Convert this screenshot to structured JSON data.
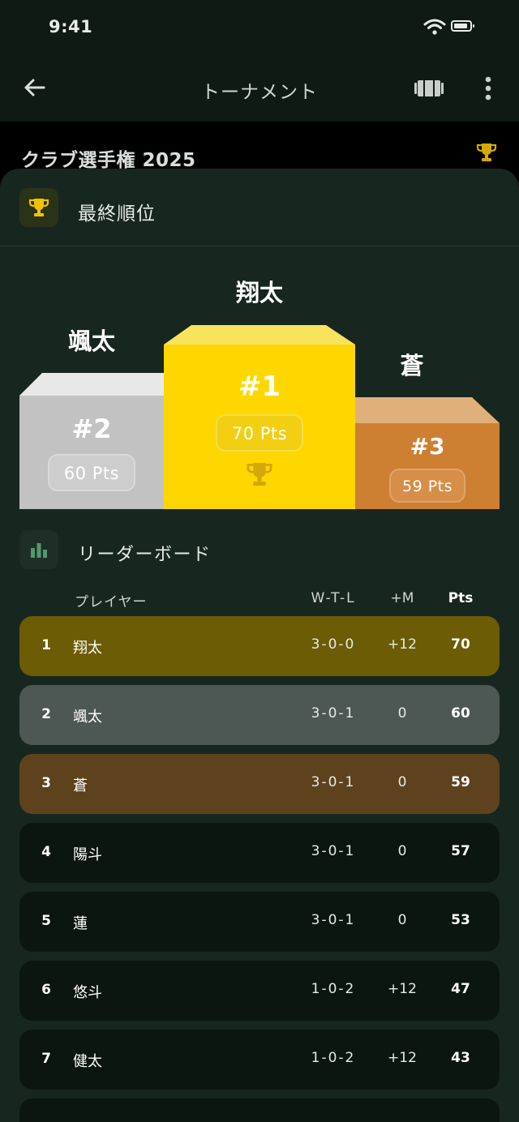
{
  "status_bar": {
    "time": "9:41"
  },
  "app_bar": {
    "title": "トーナメント",
    "back_icon": "arrow-left-icon",
    "tv_icon": "tv-icon",
    "more_icon": "more-vertical-icon"
  },
  "banner": {
    "title": "クラブ選手権 2025",
    "trophy_icon": "trophy-icon"
  },
  "final_standings": {
    "title": "最終順位",
    "icon": "trophy-icon"
  },
  "podium": {
    "first": {
      "name": "翔太",
      "rank": "#1",
      "points": "70 Pts",
      "color": "#ffd700"
    },
    "second": {
      "name": "颯太",
      "rank": "#2",
      "points": "60 Pts",
      "color": "#c0c0c0"
    },
    "third": {
      "name": "蒼",
      "rank": "#3",
      "points": "59 Pts",
      "color": "#cd7f32"
    }
  },
  "leaderboard": {
    "title": "リーダーボード",
    "icon": "bar-chart-icon",
    "columns": {
      "player": "プレイヤー",
      "wtl": "W-T-L",
      "margin": "+M",
      "pts": "Pts"
    },
    "rows": [
      {
        "rank": "1",
        "name": "翔太",
        "wtl": "3-0-0",
        "margin": "+12",
        "pts": "70",
        "bg": "#6b5c05"
      },
      {
        "rank": "2",
        "name": "颯太",
        "wtl": "3-0-1",
        "margin": "0",
        "pts": "60",
        "bg": "#4d5753"
      },
      {
        "rank": "3",
        "name": "蒼",
        "wtl": "3-0-1",
        "margin": "0",
        "pts": "59",
        "bg": "#5e421e"
      },
      {
        "rank": "4",
        "name": "陽斗",
        "wtl": "3-0-1",
        "margin": "0",
        "pts": "57",
        "bg": "#0b1611"
      },
      {
        "rank": "5",
        "name": "蓮",
        "wtl": "3-0-1",
        "margin": "0",
        "pts": "53",
        "bg": "#0b1611"
      },
      {
        "rank": "6",
        "name": "悠斗",
        "wtl": "1-0-2",
        "margin": "+12",
        "pts": "47",
        "bg": "#0b1611"
      },
      {
        "rank": "7",
        "name": "健太",
        "wtl": "1-0-2",
        "margin": "+12",
        "pts": "43",
        "bg": "#0b1611"
      }
    ]
  }
}
